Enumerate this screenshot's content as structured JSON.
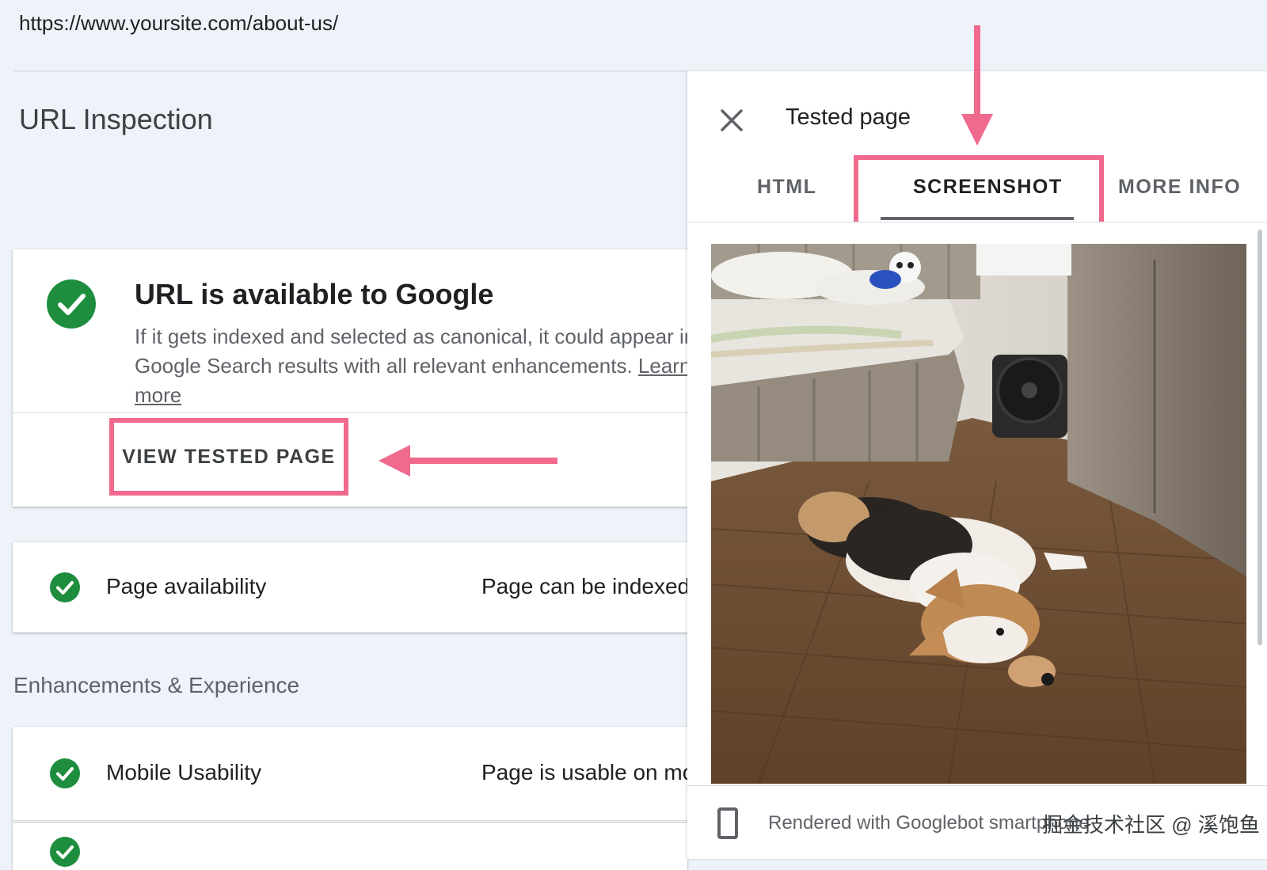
{
  "url_bar": {
    "url": "https://www.yoursite.com/about-us/"
  },
  "page": {
    "title": "URL Inspection"
  },
  "status_card": {
    "heading": "URL is available to Google",
    "description": "If it gets indexed and selected as canonical, it could appear in Google Search results with all relevant enhancements.",
    "learn_more": "Learn more",
    "view_button": "VIEW TESTED PAGE"
  },
  "checks": [
    {
      "label": "Page availability",
      "value": "Page can be indexed"
    }
  ],
  "enhancements": {
    "heading": "Enhancements & Experience",
    "items": [
      {
        "label": "Mobile Usability",
        "value": "Page is usable on mobile"
      }
    ]
  },
  "panel": {
    "title": "Tested page",
    "tabs": [
      "HTML",
      "SCREENSHOT",
      "MORE INFO"
    ],
    "active_tab": "SCREENSHOT",
    "footer": "Rendered with Googlebot smartphone",
    "watermark": "掘金技术社区 @ 溪饱鱼"
  },
  "colors": {
    "highlight": "#f06a8d",
    "success": "#1e8e3e",
    "page_bg": "#eef2f9"
  },
  "icons": [
    "check-circle-icon",
    "close-icon",
    "smartphone-icon",
    "arrow-left-icon",
    "arrow-down-icon"
  ]
}
